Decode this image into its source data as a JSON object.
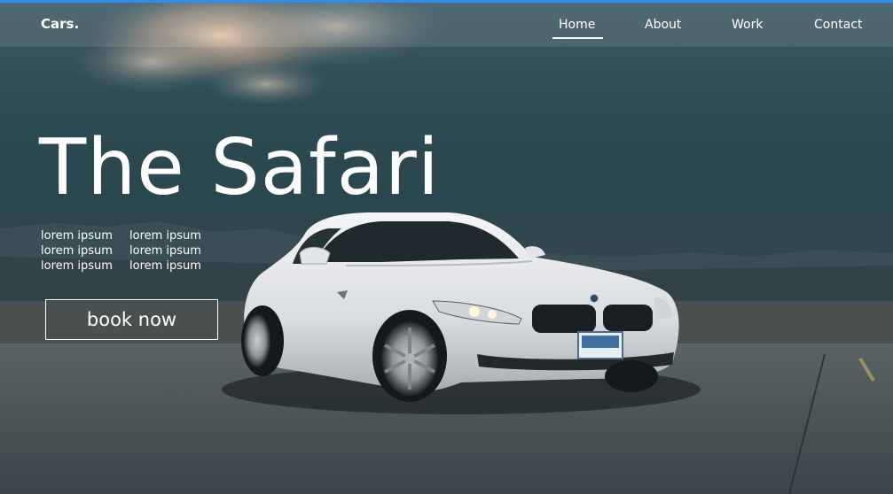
{
  "brand": {
    "name": "Cars."
  },
  "nav": {
    "items": [
      {
        "label": "Home",
        "active": true
      },
      {
        "label": "About"
      },
      {
        "label": "Work"
      },
      {
        "label": "Contact"
      }
    ]
  },
  "hero": {
    "title": "The Safari",
    "lorem": [
      "lorem ipsum",
      "lorem ipsum",
      "lorem ipsum",
      "lorem ipsum",
      "lorem ipsum",
      "lorem ipsum"
    ],
    "cta_label": "book now"
  },
  "colors": {
    "accent_line": "#2f8df2",
    "text": "#ffffff",
    "car_body": "#e6e8ea"
  }
}
